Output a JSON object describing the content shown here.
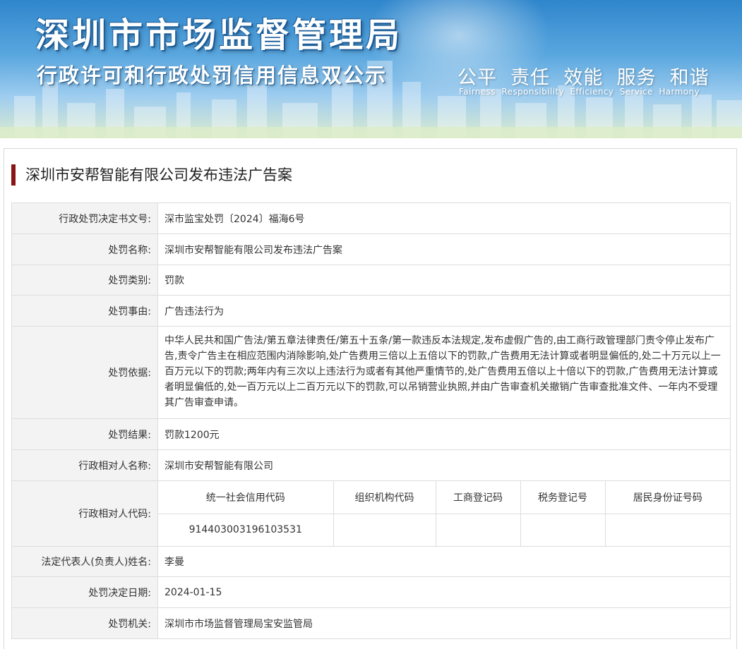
{
  "banner": {
    "title": "深圳市市场监督管理局",
    "subtitle": "行政许可和行政处罚信用信息双公示",
    "motto": "公平  责任  效能  服务  和谐",
    "motto_en": "Fairness  Responsibility  Efficiency  Service  Harmony"
  },
  "case_title": "深圳市安帮智能有限公司发布违法广告案",
  "rows": [
    {
      "label": "行政处罚决定书文号:",
      "value": "深市监宝处罚〔2024〕福海6号"
    },
    {
      "label": "处罚名称:",
      "value": "深圳市安帮智能有限公司发布违法广告案"
    },
    {
      "label": "处罚类别:",
      "value": "罚款"
    },
    {
      "label": "处罚事由:",
      "value": "广告违法行为"
    },
    {
      "label": "处罚依据:",
      "value": "中华人民共和国广告法/第五章法律责任/第五十五条/第一款违反本法规定,发布虚假广告的,由工商行政管理部门责令停止发布广告,责令广告主在相应范围内消除影响,处广告费用三倍以上五倍以下的罚款,广告费用无法计算或者明显偏低的,处二十万元以上一百万元以下的罚款;两年内有三次以上违法行为或者有其他严重情节的,处广告费用五倍以上十倍以下的罚款,广告费用无法计算或者明显偏低的,处一百万元以上二百万元以下的罚款,可以吊销营业执照,并由广告审查机关撤销广告审查批准文件、一年内不受理其广告审查申请。"
    },
    {
      "label": "处罚结果:",
      "value": "罚款1200元"
    },
    {
      "label": "行政相对人名称:",
      "value": "深圳市安帮智能有限公司"
    },
    {
      "label": "行政相对人代码:"
    },
    {
      "label": "法定代表人(负责人)姓名:",
      "value": "李曼"
    },
    {
      "label": "处罚决定日期:",
      "value": "2024-01-15"
    },
    {
      "label": "处罚机关:",
      "value": "深圳市市场监督管理局宝安监管局"
    }
  ],
  "codes": {
    "headers": [
      "统一社会信用代码",
      "组织机构代码",
      "工商登记码",
      "税务登记号",
      "居民身份证号码"
    ],
    "values": [
      "914403003196103531",
      "",
      "",
      "",
      ""
    ]
  }
}
